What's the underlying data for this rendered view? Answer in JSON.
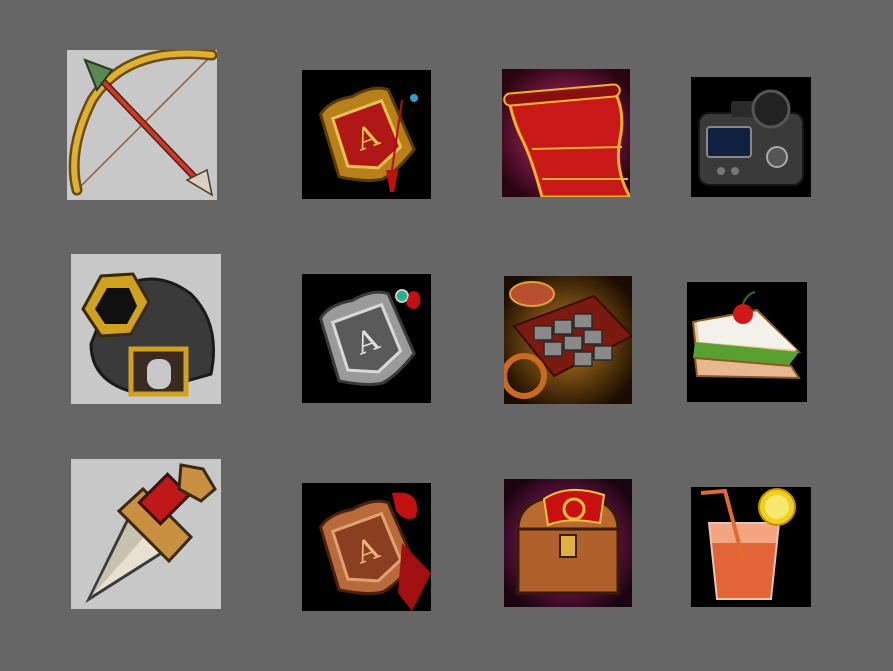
{
  "sheet": {
    "background": "#666666",
    "rows": [
      [
        {
          "icon": "bow-and-arrow-icon",
          "background": "#c8c8c8"
        },
        {
          "icon": "gold-token-pendant-icon",
          "background": "#000000"
        },
        {
          "icon": "red-scroll-icon",
          "background": "#000000"
        },
        {
          "icon": "camera-icon",
          "background": "#000000"
        }
      ],
      [
        {
          "icon": "cannon-icon",
          "background": "#c8c8c8"
        },
        {
          "icon": "silver-token-pendant-icon",
          "background": "#000000"
        },
        {
          "icon": "stone-cart-icon",
          "background": "#000000"
        },
        {
          "icon": "sandwich-icon",
          "background": "#000000"
        }
      ],
      [
        {
          "icon": "dagger-icon",
          "background": "#c8c8c8"
        },
        {
          "icon": "bronze-token-pendant-icon",
          "background": "#000000"
        },
        {
          "icon": "treasure-chest-icon",
          "background": "#000000"
        },
        {
          "icon": "orange-juice-icon",
          "background": "#000000"
        }
      ]
    ]
  }
}
